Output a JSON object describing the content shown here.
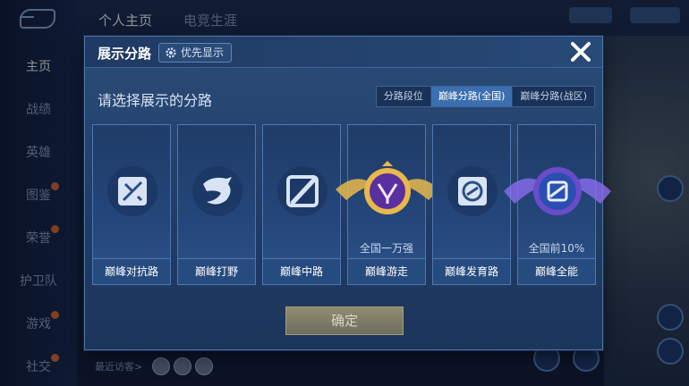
{
  "sidebar": {
    "items": [
      {
        "label": "主页",
        "active": true,
        "badge": false
      },
      {
        "label": "战绩",
        "active": false,
        "badge": false
      },
      {
        "label": "英雄",
        "active": false,
        "badge": false
      },
      {
        "label": "图鉴",
        "active": false,
        "badge": true
      },
      {
        "label": "荣誉",
        "active": false,
        "badge": true
      },
      {
        "label": "护卫队",
        "active": false,
        "badge": false
      },
      {
        "label": "游戏",
        "active": false,
        "badge": true
      },
      {
        "label": "社交",
        "active": false,
        "badge": true
      }
    ]
  },
  "topbar": {
    "tabs": [
      {
        "label": "个人主页",
        "active": true
      },
      {
        "label": "电竞生涯",
        "active": false
      }
    ]
  },
  "footer": {
    "recent_visitors_label": "最近访客>"
  },
  "modal": {
    "title": "展示分路",
    "priority_label": "优先显示",
    "prompt": "请选择展示的分路",
    "segments": [
      {
        "label": "分路段位",
        "active": false
      },
      {
        "label": "巅峰分路(全国)",
        "active": true
      },
      {
        "label": "巅峰分路(战区)",
        "active": false
      }
    ],
    "cards": [
      {
        "label": "巅峰对抗路",
        "rank": "",
        "icon": "sword-cross-icon"
      },
      {
        "label": "巅峰打野",
        "rank": "",
        "icon": "dragon-icon"
      },
      {
        "label": "巅峰中路",
        "rank": "",
        "icon": "diagonal-slash-icon"
      },
      {
        "label": "巅峰游走",
        "rank": "全国一万强",
        "icon": "gold-winged-emblem-icon"
      },
      {
        "label": "巅峰发育路",
        "rank": "",
        "icon": "ring-s-icon"
      },
      {
        "label": "巅峰全能",
        "rank": "全国前10%",
        "icon": "purple-winged-emblem-icon"
      }
    ],
    "confirm_label": "确定"
  },
  "colors": {
    "accent": "#3b6fb0",
    "gold": "#e8b84a",
    "purple": "#6a4cc9"
  }
}
